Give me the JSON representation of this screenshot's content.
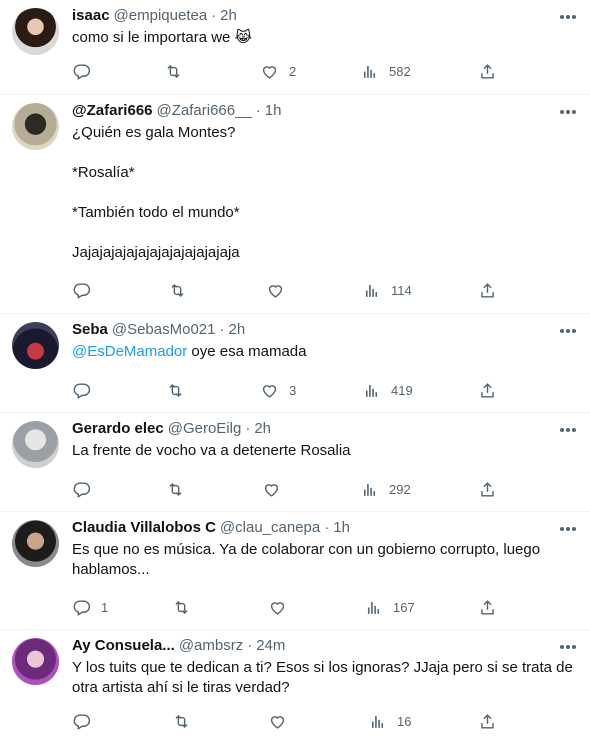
{
  "tweets": [
    {
      "name": "isaac",
      "handle": "@empiquetea",
      "time": "2h",
      "text": "como si le importara we 😹",
      "replies": "",
      "retweets": "",
      "likes": "2",
      "views": "582"
    },
    {
      "name": "@Zafari666",
      "handle": "@Zafari666__",
      "time": "1h",
      "text": "¿Quién es gala Montes?\n\n*Rosalía*\n\n*También todo el mundo*\n\nJajajajajajajajajajajajajaja",
      "replies": "",
      "retweets": "",
      "likes": "",
      "views": "114"
    },
    {
      "name": "Seba",
      "handle": "@SebasMo021",
      "time": "2h",
      "mention": "@EsDeMamador",
      "text": " oye esa mamada",
      "replies": "",
      "retweets": "",
      "likes": "3",
      "views": "419"
    },
    {
      "name": "Gerardo elec",
      "handle": "@GeroEilg",
      "time": "2h",
      "text": "La frente de vocho va a detenerte Rosalia",
      "replies": "",
      "retweets": "",
      "likes": "",
      "views": "292"
    },
    {
      "name": "Claudia Villalobos C",
      "handle": "@clau_canepa",
      "time": "1h",
      "text": "Es que no es música. Ya de colaborar con un gobierno corrupto, luego\nhablamos...",
      "replies": "1",
      "retweets": "",
      "likes": "",
      "views": "167"
    },
    {
      "name": "Ay Consuela...",
      "handle": "@ambsrz",
      "time": "24m",
      "text": "Y los tuits que te dedican a ti? Esos si los ignoras? JJaja pero si se trata de\notra artista ahí si le tiras verdad?",
      "replies": "",
      "retweets": "",
      "likes": "",
      "views": "16"
    }
  ],
  "dot": "·",
  "colors": {
    "text": "#0f1419",
    "secondary": "#536471",
    "link": "#1d9bf0",
    "divider": "#eff3f4"
  },
  "icons": [
    "more-icon",
    "reply-icon",
    "retweet-icon",
    "like-icon",
    "views-icon",
    "share-icon"
  ]
}
